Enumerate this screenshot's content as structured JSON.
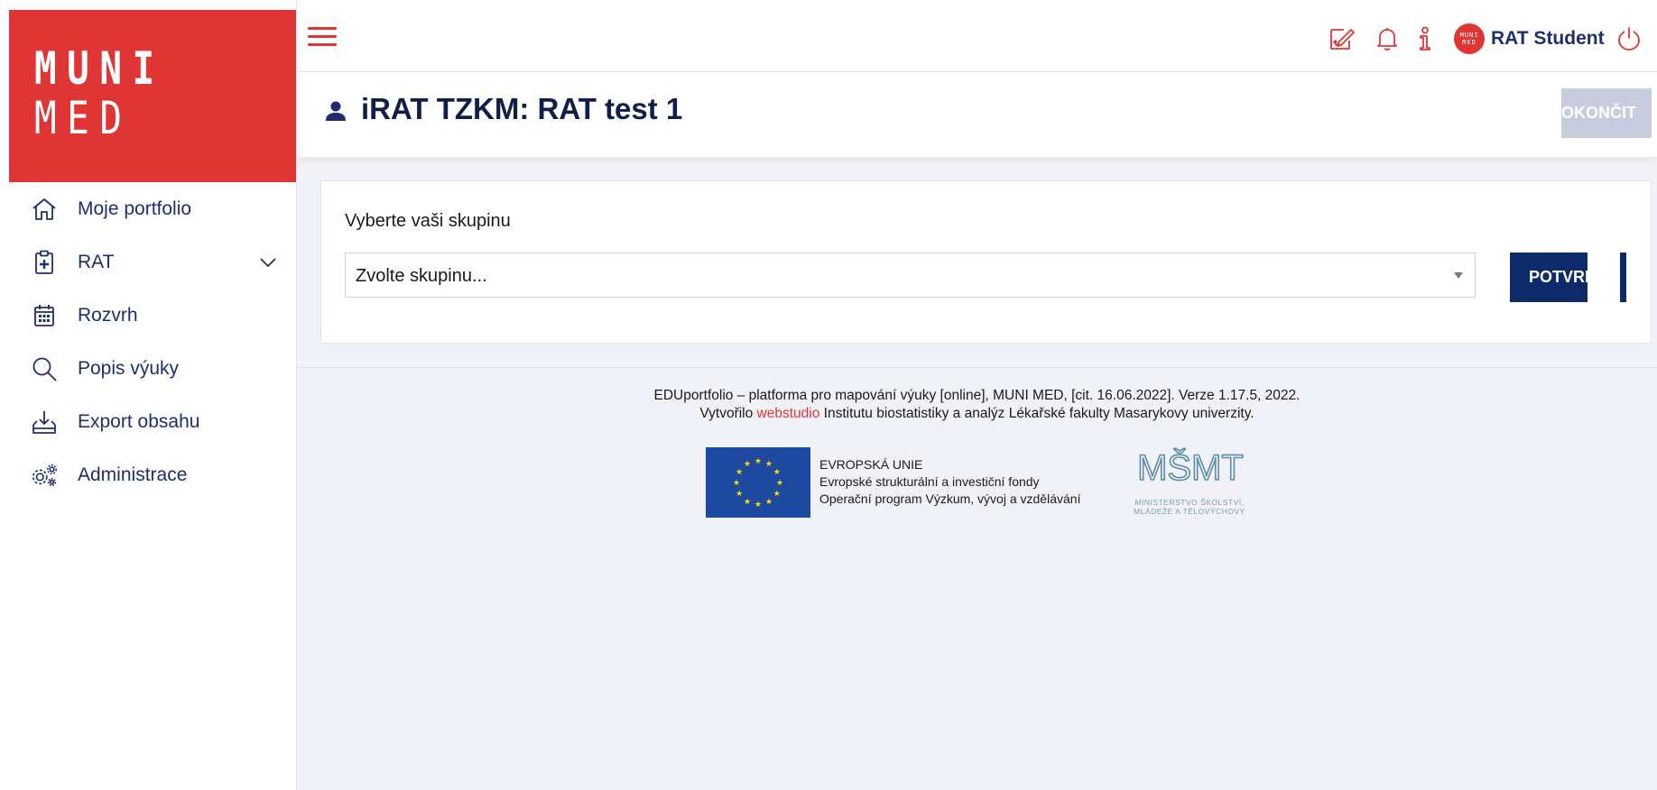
{
  "logo": {
    "line1": "MUNI",
    "line2": "MED"
  },
  "sidebar": {
    "items": [
      {
        "label": "Moje portfolio",
        "icon": "home-icon"
      },
      {
        "label": "RAT",
        "icon": "clipboard-plus-icon",
        "expandable": true
      },
      {
        "label": "Rozvrh",
        "icon": "calendar-icon"
      },
      {
        "label": "Popis výuky",
        "icon": "search-icon"
      },
      {
        "label": "Export obsahu",
        "icon": "download-tray-icon"
      },
      {
        "label": "Administrace",
        "icon": "gears-icon"
      }
    ]
  },
  "topbar": {
    "icons": [
      "signature-icon",
      "bell-icon",
      "info-icon",
      "power-icon"
    ],
    "user": {
      "avatar_line1": "MUNI",
      "avatar_line2": "MED",
      "name": "RAT Student"
    }
  },
  "header": {
    "title": "iRAT TZKM: RAT test 1",
    "end_button": "OKONČIT"
  },
  "group_form": {
    "label": "Vyberte vaši skupinu",
    "select_value": "Zvolte skupinu...",
    "confirm_button": "POTVRDIT"
  },
  "footer": {
    "line1": "EDUportfolio – platforma pro mapování výuky [online], MUNI MED, [cit. 16.06.2022]. Verze 1.17.5, 2022.",
    "line2_prefix": "Vytvořilo ",
    "line2_link": "webstudio",
    "line2_suffix": " Institutu biostatistiky a analýz Lékařské fakulty Masarykovy univerzity.",
    "eu": {
      "line1": "EVROPSKÁ UNIE",
      "line2": "Evropské strukturální a investiční fondy",
      "line3": "Operační program Výzkum, vývoj a vzdělávání"
    },
    "msmt": {
      "logo_text": "MŠMT",
      "line1": "MINISTERSTVO ŠKOLSTVÍ,",
      "line2": "MLÁDEŽE A TĚLOVÝCHOVY"
    }
  },
  "colors": {
    "brand_red": "#df3635",
    "navy": "#1d2f6f",
    "button_navy": "#0d2a6b",
    "disabled_button": "#c7ccdf",
    "background": "#f1f2f7",
    "eu_blue": "#1d4aa0",
    "eu_star": "#ffdd00"
  }
}
